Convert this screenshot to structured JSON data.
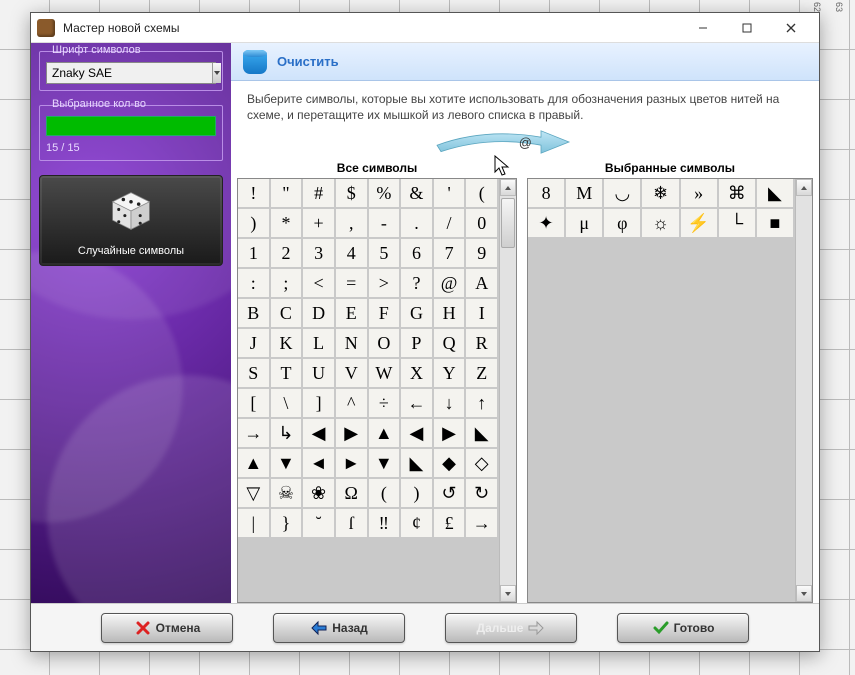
{
  "window": {
    "title": "Мастер новой схемы"
  },
  "sidebar": {
    "font_group_label": "Шрифт символов",
    "font_value": "Znaky SAE",
    "count_group_label": "Выбранное кол-во",
    "count_text": "15 / 15",
    "random_label": "Случайные символы"
  },
  "main": {
    "clear_label": "Очистить",
    "instructions": "Выберите символы, которые вы хотите использовать для обозначения разных цветов нитей на схеме, и перетащите их мышкой из левого списка в правый.",
    "arrow_center_char": "@",
    "all_title": "Все символы",
    "selected_title": "Выбранные символы",
    "all_symbols": [
      "!",
      "\"",
      "#",
      "$",
      "%",
      "&",
      "'",
      "(",
      ")",
      "*",
      "+",
      ",",
      "-",
      ".",
      "/",
      "0",
      "1",
      "2",
      "3",
      "4",
      "5",
      "6",
      "7",
      "9",
      ":",
      ";",
      "<",
      "=",
      ">",
      "?",
      "@",
      "A",
      "B",
      "C",
      "D",
      "E",
      "F",
      "G",
      "H",
      "I",
      "J",
      "K",
      "L",
      "N",
      "O",
      "P",
      "Q",
      "R",
      "S",
      "T",
      "U",
      "V",
      "W",
      "X",
      "Y",
      "Z",
      "[",
      "\\",
      "]",
      "^",
      "÷",
      "←",
      "↓",
      "↑",
      "→",
      "↳",
      "◀",
      "▶",
      "▲",
      "◀",
      "▶",
      "◣",
      "▲",
      "▼",
      "◄",
      "►",
      "▼",
      "◣",
      "◆",
      "◇",
      "▽",
      "☠",
      "❀",
      "Ω",
      "(",
      ")",
      "↺",
      "↻",
      "|",
      "}",
      "˘",
      "ſ",
      "‼",
      "¢",
      "£",
      "→"
    ],
    "selected_symbols": [
      "8",
      "M",
      "◡",
      "❄",
      "»",
      "⌘",
      "◣",
      "✦",
      "μ",
      "φ",
      "☼",
      "⚡",
      "└",
      "■"
    ]
  },
  "footer": {
    "cancel": "Отмена",
    "back": "Назад",
    "next": "Дальше",
    "finish": "Готово"
  }
}
